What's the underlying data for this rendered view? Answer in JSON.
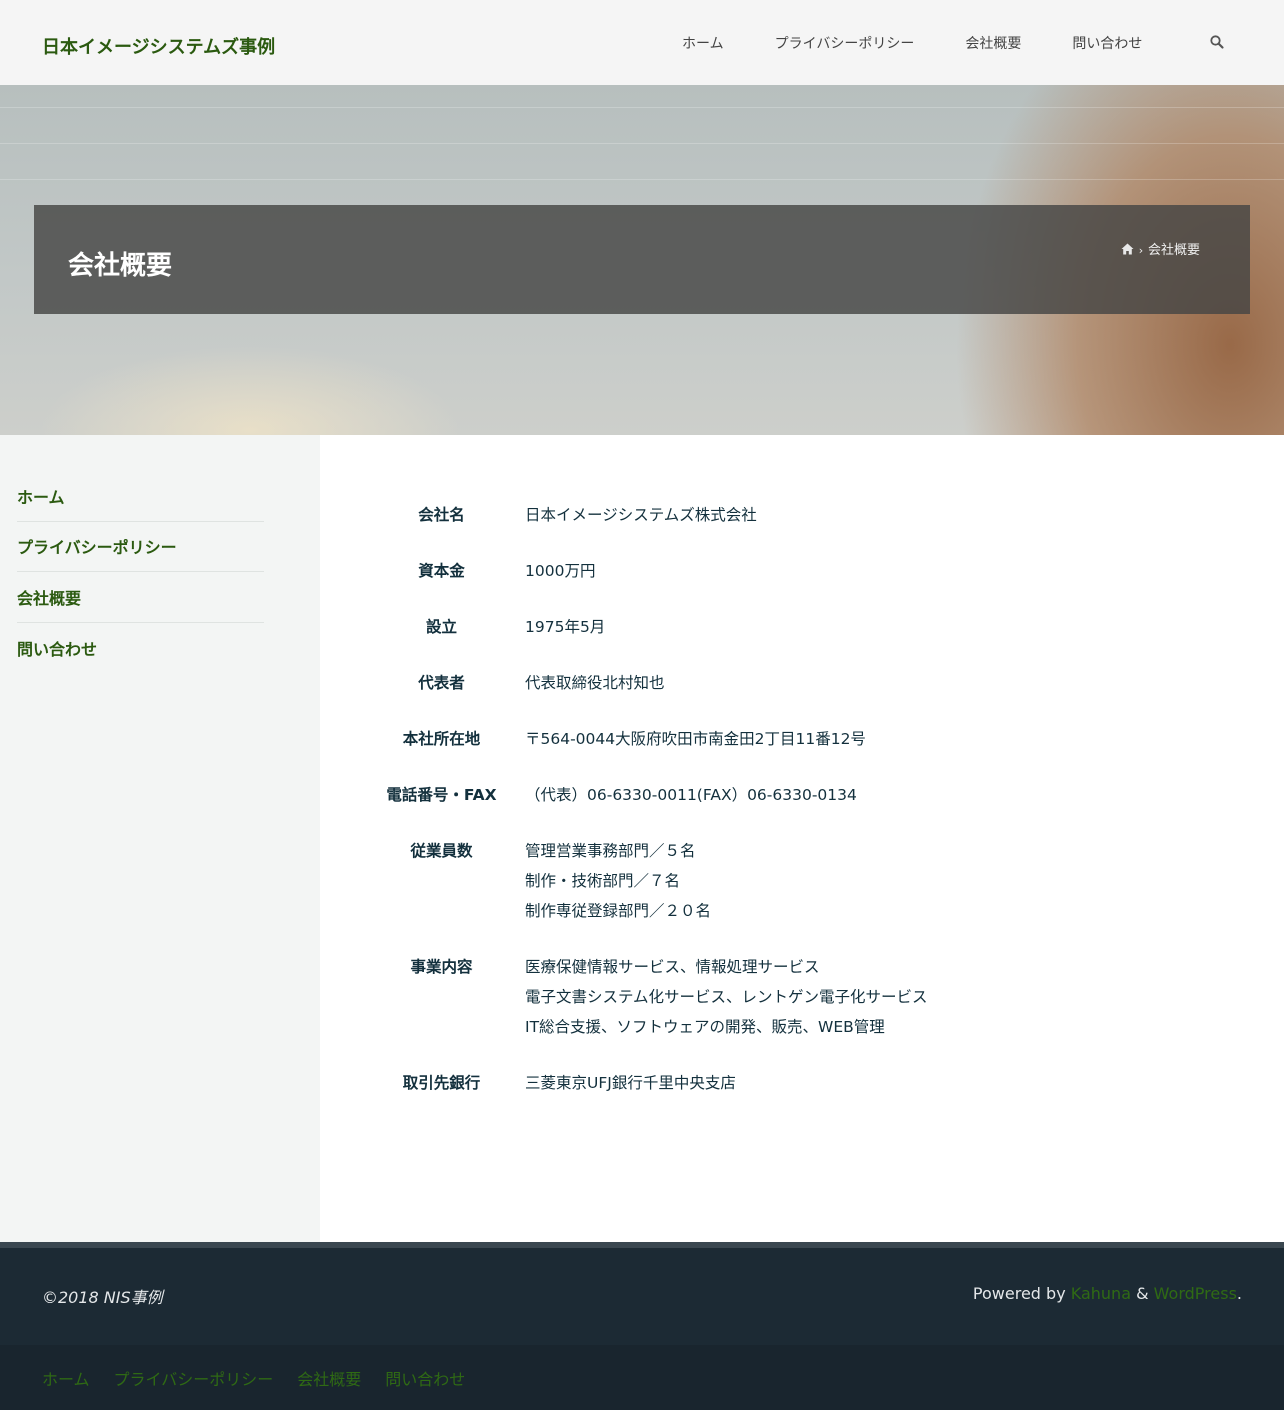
{
  "site": {
    "title": "日本イメージシステムズ事例"
  },
  "top_nav": {
    "items": [
      "ホーム",
      "プライバシーポリシー",
      "会社概要",
      "問い合わせ"
    ]
  },
  "icons": {
    "search": "search-icon",
    "home": "home-icon",
    "chevron": "chevron-right-icon"
  },
  "hero": {
    "title": "会社概要",
    "breadcrumb": {
      "separator": "›",
      "current": "会社概要"
    }
  },
  "sidebar": {
    "items": [
      "ホーム",
      "プライバシーポリシー",
      "会社概要",
      "問い合わせ"
    ]
  },
  "company": {
    "rows": [
      {
        "label": "会社名",
        "lines": [
          "日本イメージシステムズ株式会社"
        ]
      },
      {
        "label": "資本金",
        "lines": [
          "1000万円"
        ]
      },
      {
        "label": "設立",
        "lines": [
          "1975年5月"
        ]
      },
      {
        "label": "代表者",
        "lines": [
          "代表取締役北村知也"
        ]
      },
      {
        "label": "本社所在地",
        "lines": [
          "〒564-0044大阪府吹田市南金田2丁目11番12号"
        ]
      },
      {
        "label": "電話番号・FAX",
        "lines": [
          "（代表）06-6330-0011(FAX）06-6330-0134"
        ]
      },
      {
        "label": "従業員数",
        "lines": [
          "管理営業事務部門／５名",
          "制作・技術部門／７名",
          "制作専従登録部門／２０名"
        ]
      },
      {
        "label": "事業内容",
        "lines": [
          "医療保健情報サービス、情報処理サービス",
          "電子文書システム化サービス、レントゲン電子化サービス",
          "IT総合支援、ソフトウェアの開発、販売、WEB管理"
        ]
      },
      {
        "label": "取引先銀行",
        "lines": [
          "三菱東京UFJ銀行千里中央支店"
        ]
      }
    ]
  },
  "footer": {
    "copyright": "©2018 NIS事例",
    "powered_prefix": "Powered by",
    "kahuna": "Kahuna",
    "amp": "&",
    "wordpress": "WordPress",
    "period": ".",
    "nav": [
      "ホーム",
      "プライバシーポリシー",
      "会社概要",
      "問い合わせ"
    ]
  },
  "colors": {
    "accent": "#2b5a10",
    "footer_bg": "#1c2a34",
    "text": "#13303d"
  }
}
